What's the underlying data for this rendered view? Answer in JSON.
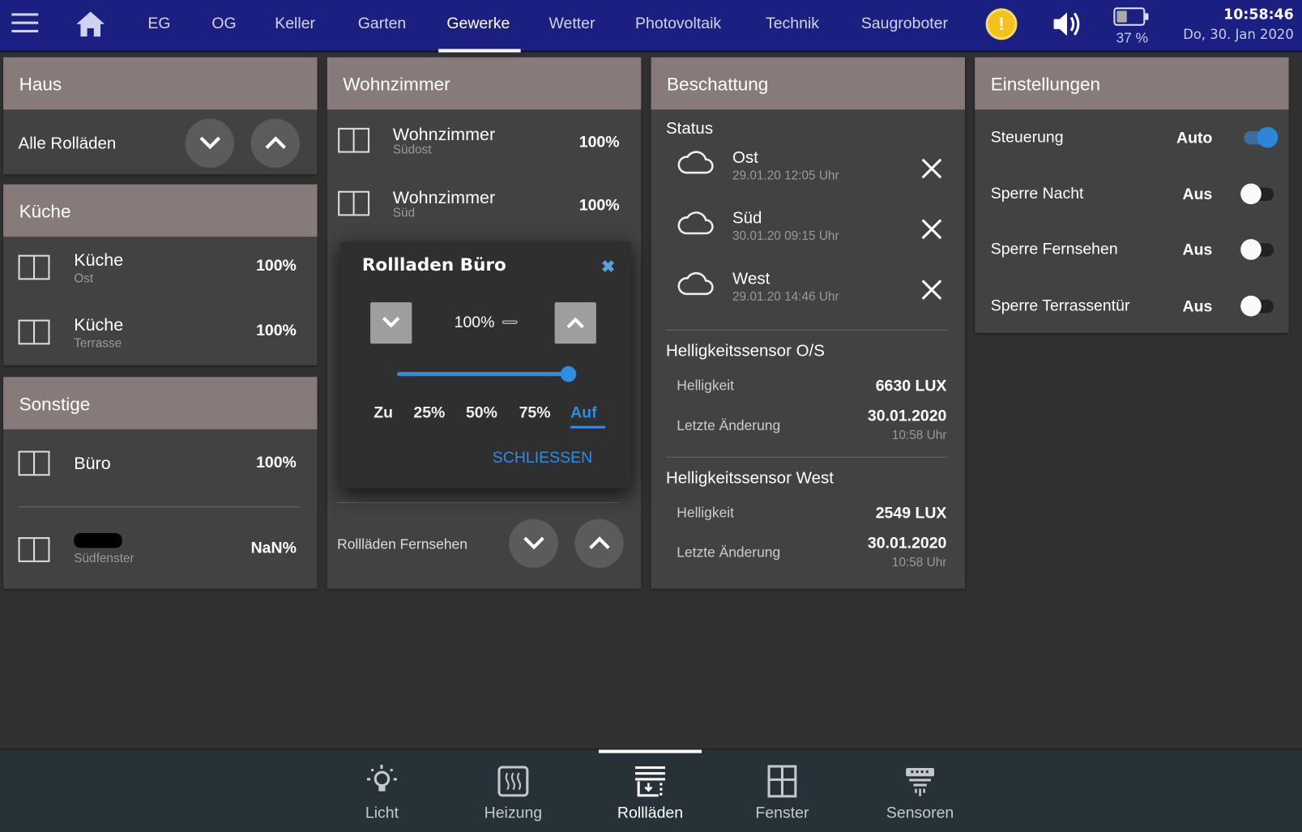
{
  "topbar": {
    "tabs": [
      "EG",
      "OG",
      "Keller",
      "Garten",
      "Gewerke",
      "Wetter",
      "Photovoltaik",
      "Technik",
      "Saugroboter"
    ],
    "active_tab": "Gewerke",
    "warning": "!",
    "battery_percent": 37,
    "battery_label": "37 %",
    "time": "10:58:46",
    "date": "Do, 30. Jan 2020"
  },
  "haus": {
    "title": "Haus",
    "row_label": "Alle Rolläden"
  },
  "kueche": {
    "title": "Küche",
    "items": [
      {
        "name": "Küche",
        "sub": "Ost",
        "value": "100%"
      },
      {
        "name": "Küche",
        "sub": "Terrasse",
        "value": "100%"
      }
    ]
  },
  "sonstige": {
    "title": "Sonstige",
    "items": [
      {
        "name": "Büro",
        "sub": "",
        "value": "100%"
      },
      {
        "name": "",
        "sub": "Südfenster",
        "value": "NaN%"
      }
    ]
  },
  "wohnzimmer": {
    "title": "Wohnzimmer",
    "items": [
      {
        "name": "Wohnzimmer",
        "sub": "Südost",
        "value": "100%"
      },
      {
        "name": "Wohnzimmer",
        "sub": "Süd",
        "value": "100%"
      }
    ],
    "footer_label": "Rollläden Fernsehen"
  },
  "dialog": {
    "title": "Rollladen Büro",
    "value": "100%",
    "slider_percent": 100,
    "presets": [
      "Zu",
      "25%",
      "50%",
      "75%",
      "Auf"
    ],
    "active_preset": "Auf",
    "close_label": "SCHLIESSEN",
    "accent": "#2e8de0"
  },
  "beschattung": {
    "title": "Beschattung",
    "status_title": "Status",
    "status": [
      {
        "name": "Ost",
        "time": "29.01.20 12:05 Uhr"
      },
      {
        "name": "Süd",
        "time": "30.01.20 09:15 Uhr"
      },
      {
        "name": "West",
        "time": "29.01.20 14:46 Uhr"
      }
    ],
    "sensors": [
      {
        "title": "Helligkeitssensor O/S",
        "brightness_label": "Helligkeit",
        "brightness": "6630 LUX",
        "changed_label": "Letzte Änderung",
        "date": "30.01.2020",
        "time": "10:58 Uhr"
      },
      {
        "title": "Helligkeitssensor West",
        "brightness_label": "Helligkeit",
        "brightness": "2549 LUX",
        "changed_label": "Letzte Änderung",
        "date": "30.01.2020",
        "time": "10:58 Uhr"
      }
    ]
  },
  "einstellungen": {
    "title": "Einstellungen",
    "items": [
      {
        "label": "Steuerung",
        "value": "Auto",
        "on": true
      },
      {
        "label": "Sperre Nacht",
        "value": "Aus",
        "on": false
      },
      {
        "label": "Sperre Fernsehen",
        "value": "Aus",
        "on": false
      },
      {
        "label": "Sperre Terrassentür",
        "value": "Aus",
        "on": false
      }
    ]
  },
  "bottom_nav": {
    "items": [
      "Licht",
      "Heizung",
      "Rollläden",
      "Fenster",
      "Sensoren"
    ],
    "active": "Rollläden"
  }
}
